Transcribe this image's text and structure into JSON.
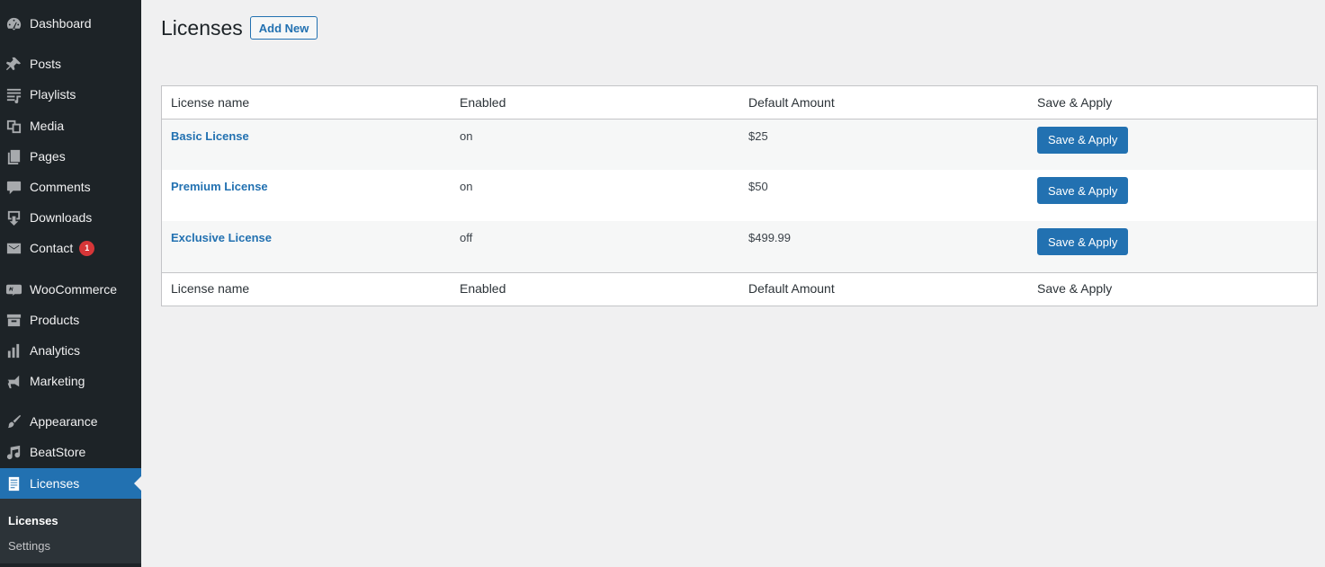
{
  "sidebar": {
    "items": [
      {
        "label": "Dashboard",
        "icon": "dashboard-icon"
      },
      {
        "label": "Posts",
        "icon": "pin-icon"
      },
      {
        "label": "Playlists",
        "icon": "playlist-icon"
      },
      {
        "label": "Media",
        "icon": "media-icon"
      },
      {
        "label": "Pages",
        "icon": "pages-icon"
      },
      {
        "label": "Comments",
        "icon": "comment-icon"
      },
      {
        "label": "Downloads",
        "icon": "download-icon"
      },
      {
        "label": "Contact",
        "icon": "mail-icon",
        "badge": "1"
      },
      {
        "label": "WooCommerce",
        "icon": "woo-icon"
      },
      {
        "label": "Products",
        "icon": "archive-icon"
      },
      {
        "label": "Analytics",
        "icon": "bar-chart-icon"
      },
      {
        "label": "Marketing",
        "icon": "megaphone-icon"
      },
      {
        "label": "Appearance",
        "icon": "brush-icon"
      },
      {
        "label": "BeatStore",
        "icon": "music-icon"
      },
      {
        "label": "Licenses",
        "icon": "document-icon",
        "active": true
      }
    ],
    "submenu": [
      {
        "label": "Licenses",
        "current": true
      },
      {
        "label": "Settings"
      }
    ]
  },
  "header": {
    "title": "Licenses",
    "add_new": "Add New"
  },
  "table": {
    "columns": [
      "License name",
      "Enabled",
      "Default Amount",
      "Save & Apply"
    ],
    "rows": [
      {
        "name": "Basic License",
        "enabled": "on",
        "amount": "$25",
        "action": "Save & Apply"
      },
      {
        "name": "Premium License",
        "enabled": "on",
        "amount": "$50",
        "action": "Save & Apply"
      },
      {
        "name": "Exclusive License",
        "enabled": "off",
        "amount": "$499.99",
        "action": "Save & Apply"
      }
    ]
  },
  "colors": {
    "sidebar_bg": "#1d2327",
    "accent": "#2271b1",
    "badge": "#d63638"
  }
}
